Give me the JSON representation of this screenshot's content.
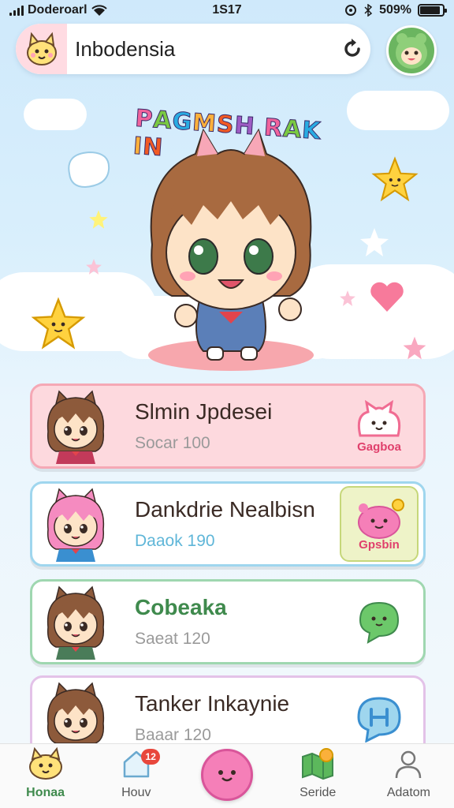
{
  "status_bar": {
    "carrier": "Doderoarl",
    "time": "1S17",
    "battery": "509%",
    "battery_level": 0.9
  },
  "search": {
    "value": "Inbodensia",
    "placeholder": ""
  },
  "hero": {
    "title": "PAGMSH RAKIN",
    "title_colors": [
      "#f0639c",
      "#7ac943",
      "#29abe2",
      "#fbb03b",
      "#f15a24",
      "#9e5cc4",
      "#f0639c",
      "#7ac943",
      "#29abe2",
      "#fbb03b",
      "#f15a24",
      "#9e5cc4"
    ]
  },
  "cards": [
    {
      "name": "Slmin Jpdesei",
      "sub": "Socar 100",
      "badge": "Gagboa",
      "name_color": "#3a2a24",
      "sub_color": "#9a9a9a",
      "bg": "#fdd9de",
      "border": "#f5a8b5",
      "hair": "#8d5a3b",
      "accent": "#c23a5a"
    },
    {
      "name": "Dankdrie Nealbisn",
      "sub": "Daaok 190",
      "badge": "Gpsbin",
      "name_color": "#3a2a24",
      "sub_color": "#5fb6d8",
      "bg": "#ffffff",
      "border": "#9fd6ee",
      "hair": "#f58bc0",
      "accent": "#3a8fd0"
    },
    {
      "name": "Cobeaka",
      "sub": "Saeat 120",
      "badge": "",
      "name_color": "#3f8a4d",
      "sub_color": "#9a9a9a",
      "bg": "#ffffff",
      "border": "#9fd7b0",
      "hair": "#8d5a3b",
      "accent": "#4a7c59"
    },
    {
      "name": "Tanker Inkaynie",
      "sub": "Baaar 120",
      "badge": "",
      "name_color": "#3a2a24",
      "sub_color": "#9a9a9a",
      "bg": "#ffffff",
      "border": "#e3c2e8",
      "hair": "#8d5a3b",
      "accent": "#5d6fb5"
    }
  ],
  "nav": {
    "items": [
      {
        "label": "Honaa",
        "icon": "mascot-home-icon"
      },
      {
        "label": "Houv",
        "icon": "house-icon"
      },
      {
        "label": "",
        "icon": "pink-blob-icon"
      },
      {
        "label": "Seride",
        "icon": "map-icon"
      },
      {
        "label": "Adatom",
        "icon": "user-icon"
      }
    ],
    "notification_count": "12"
  }
}
